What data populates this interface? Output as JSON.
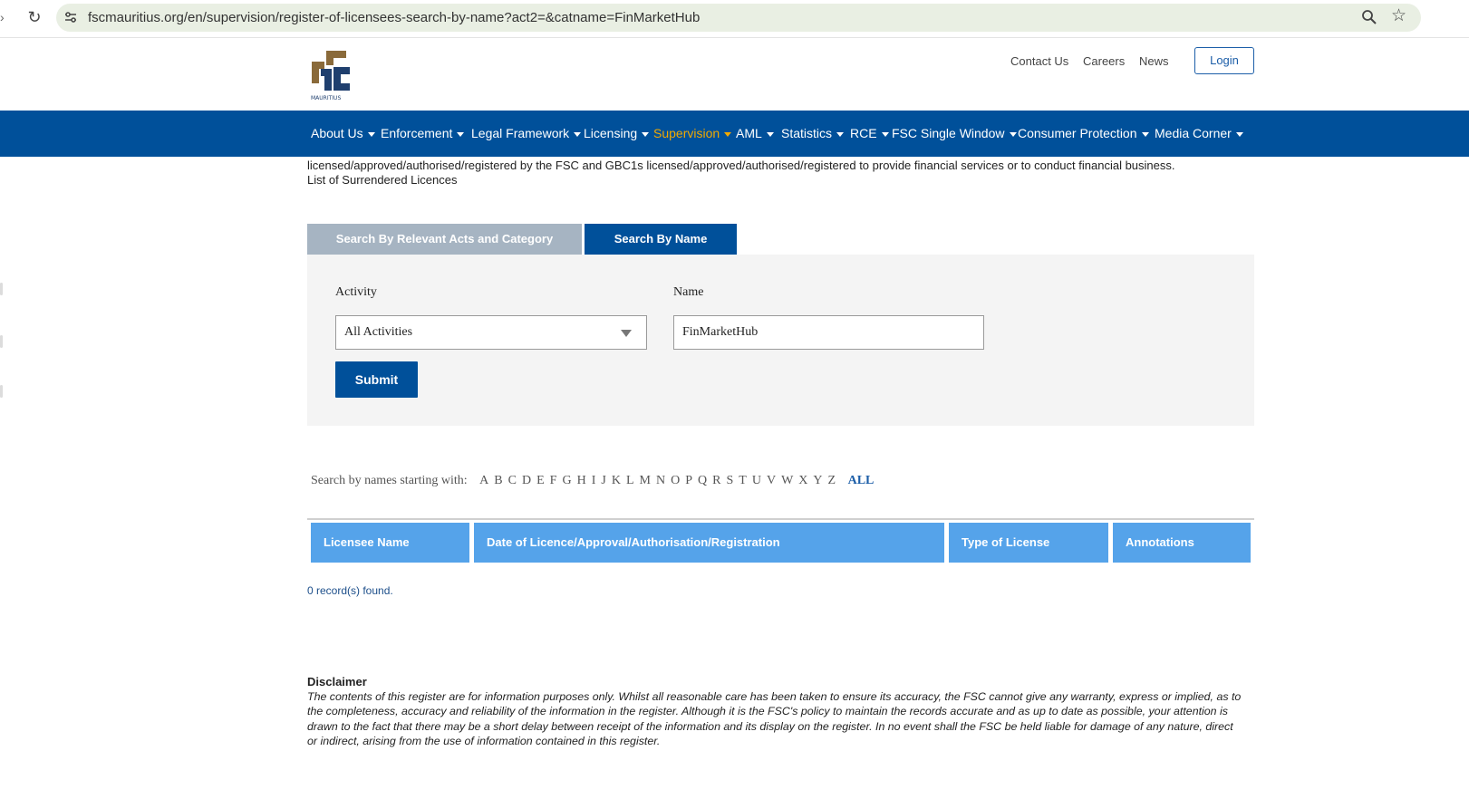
{
  "browser": {
    "url": "fscmauritius.org/en/supervision/register-of-licensees-search-by-name?act2=&catname=FinMarketHub"
  },
  "header": {
    "logo_caption": "MAURITIUS",
    "top_links": [
      "Contact Us",
      "Careers",
      "News"
    ],
    "login_label": "Login"
  },
  "nav": {
    "items": [
      {
        "label": "About Us",
        "caret": true
      },
      {
        "label": "Enforcement",
        "caret": true
      },
      {
        "label": "Legal Framework",
        "caret": true
      },
      {
        "label": "Licensing",
        "caret": true
      },
      {
        "label": "Supervision",
        "caret": true,
        "active": true
      },
      {
        "label": "AML",
        "caret": true
      },
      {
        "label": "Statistics",
        "caret": true
      },
      {
        "label": "RCE",
        "caret": true
      },
      {
        "label": "FSC Single Window",
        "caret": true
      },
      {
        "label": "Consumer Protection",
        "caret": true
      },
      {
        "label": "Media Corner",
        "caret": true
      }
    ],
    "active_color": "#f2a900",
    "bg_color": "#00509a"
  },
  "intro": {
    "line1": "licensed/approved/authorised/registered by the FSC and GBC1s licensed/approved/authorised/registered to provide financial services or to conduct financial business.",
    "line2": "List of Surrendered Licences"
  },
  "tabs": {
    "inactive_label": "Search By Relevant Acts and Category",
    "active_label": "Search By Name"
  },
  "search": {
    "activity_label": "Activity",
    "activity_value": "All Activities",
    "name_label": "Name",
    "name_value": "FinMarketHub",
    "submit_label": "Submit"
  },
  "alphabet": {
    "label": "Search by names starting with:",
    "letters": [
      "A",
      "B",
      "C",
      "D",
      "E",
      "F",
      "G",
      "H",
      "I",
      "J",
      "K",
      "L",
      "M",
      "N",
      "O",
      "P",
      "Q",
      "R",
      "S",
      "T",
      "U",
      "V",
      "W",
      "X",
      "Y",
      "Z"
    ],
    "all_label": "ALL"
  },
  "table": {
    "headers": [
      "Licensee Name",
      "Date of Licence/Approval/Authorisation/Registration",
      "Type of License",
      "Annotations"
    ],
    "records_text": "0 record(s) found.",
    "header_color": "#55a3ea"
  },
  "disclaimer": {
    "title": "Disclaimer",
    "lines": [
      "The contents of this register are for information purposes only. Whilst all reasonable care has been taken to ensure its accuracy, the FSC cannot give any warranty, express or implied, as to",
      "the completeness, accuracy and reliability of the information in the register. Although it is the FSC's policy to maintain the records accurate and as up to date as possible, your attention is",
      "drawn to the fact that there may be a short delay between receipt of the information and its display on the register. In no event shall the FSC be held liable for damage of any nature, direct",
      "or indirect, arising from the use of information contained in this register."
    ]
  }
}
